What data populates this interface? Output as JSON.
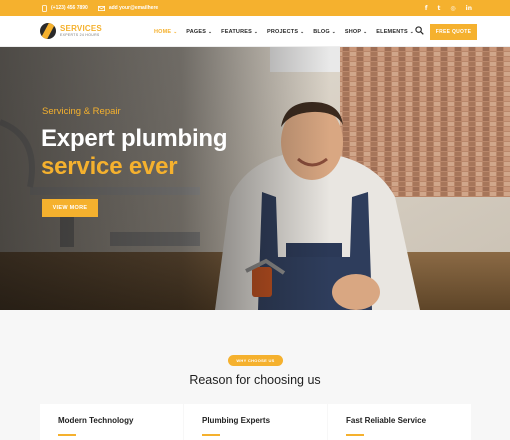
{
  "topbar": {
    "phone": "(+123) 456 7890",
    "email": "add your@emailhere",
    "social_icons": [
      "facebook-icon",
      "twitter-icon",
      "instagram-icon",
      "linkedin-icon"
    ],
    "social_glyphs": [
      "f",
      "t",
      "◎",
      "in"
    ]
  },
  "nav": {
    "logo_title": "SERVICES",
    "logo_tagline": "EXPERTS 24 HOURS",
    "items": [
      {
        "label": "HOME"
      },
      {
        "label": "PAGES"
      },
      {
        "label": "FEATURES"
      },
      {
        "label": "PROJECTS"
      },
      {
        "label": "BLOG"
      },
      {
        "label": "SHOP"
      },
      {
        "label": "ELEMENTS"
      }
    ],
    "chevron": "⌄",
    "quote_label": "FREE QUOTE"
  },
  "hero": {
    "kicker": "Servicing & Repair",
    "title_line1": "Expert plumbing",
    "title_line2": "service ever",
    "button_label": "VIEW MORE"
  },
  "why": {
    "badge": "WHY CHOOSE US",
    "title": "Reason for choosing us",
    "cards": [
      {
        "title": "Modern Technology"
      },
      {
        "title": "Plumbing Experts"
      },
      {
        "title": "Fast Reliable Service"
      }
    ]
  },
  "colors": {
    "accent": "#f5b12e",
    "dark_text": "#1f1f1f",
    "section_bg": "#f7f7f7"
  }
}
